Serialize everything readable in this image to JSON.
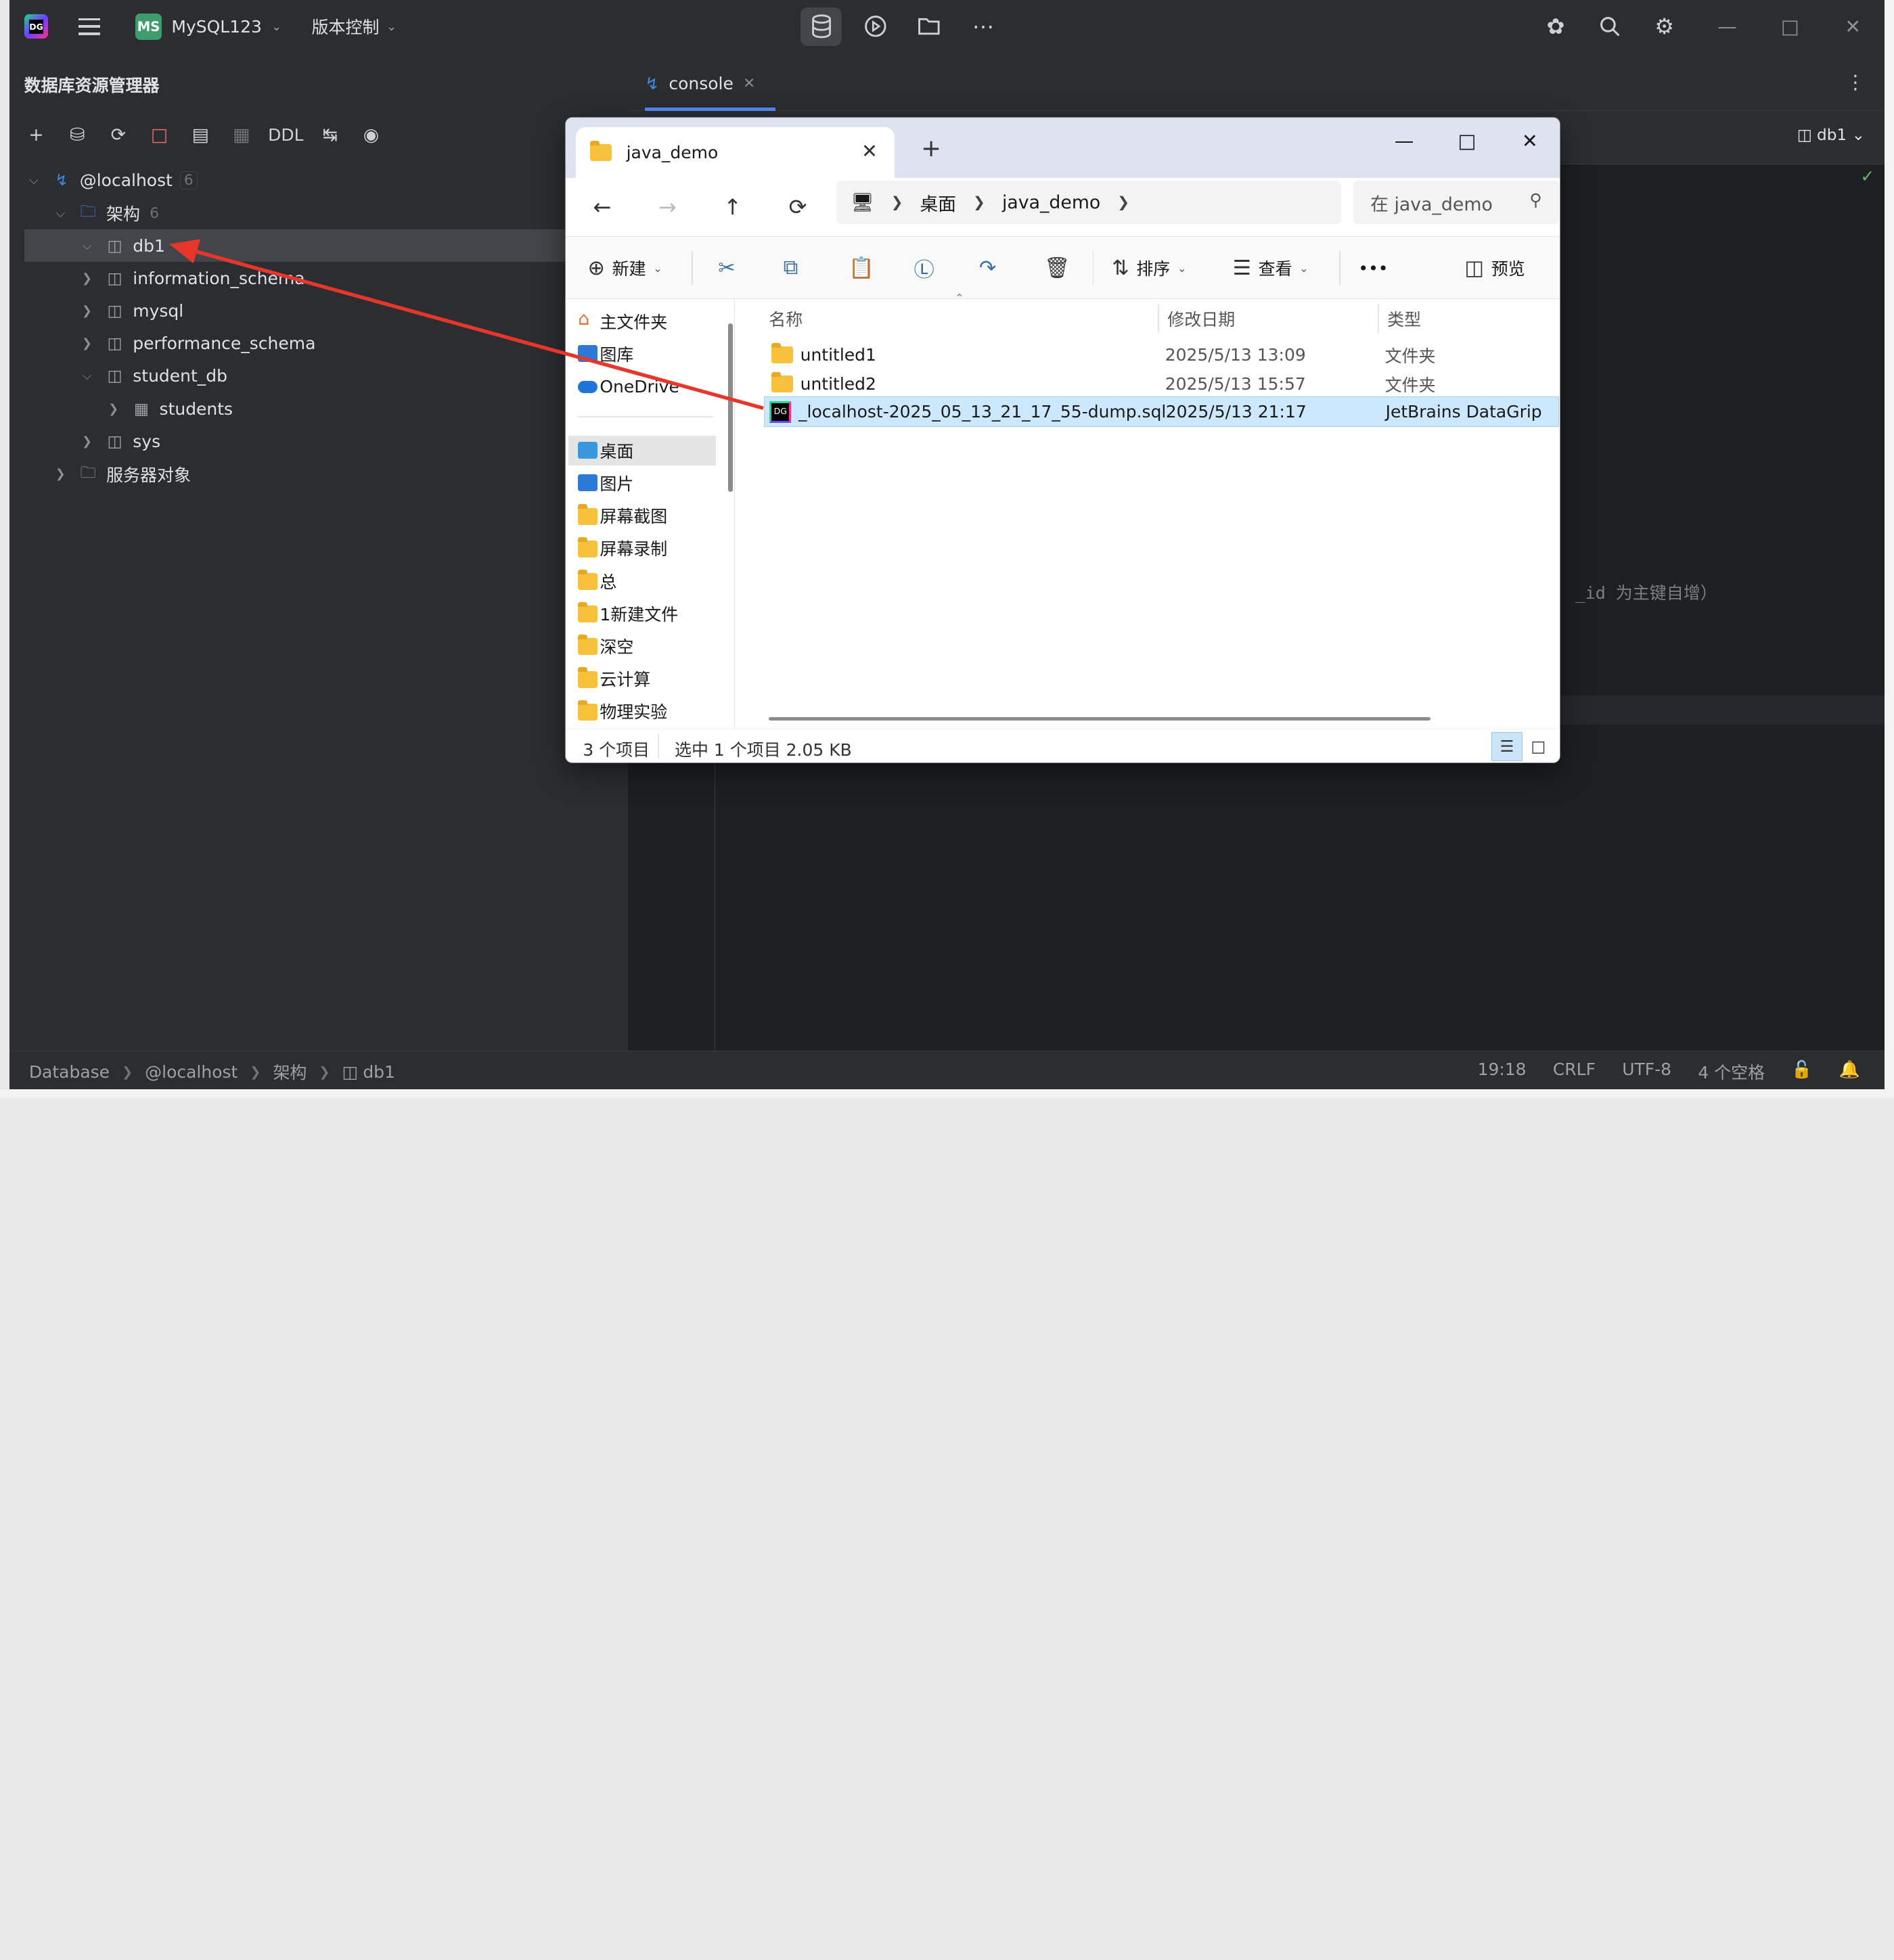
{
  "ide": {
    "project": {
      "badge": "MS",
      "name": "MySQL123"
    },
    "vcs": "版本控制",
    "panel_title": "数据库资源管理器",
    "toolbar_ddl": "DDL",
    "tree": [
      {
        "label": "@localhost",
        "count": "6"
      },
      {
        "label": "架构",
        "count": "6"
      },
      {
        "label": "db1"
      },
      {
        "label": "information_schema"
      },
      {
        "label": "mysql"
      },
      {
        "label": "performance_schema"
      },
      {
        "label": "student_db"
      },
      {
        "label": "students"
      },
      {
        "label": "sys"
      },
      {
        "label": "服务器对象"
      }
    ],
    "editor_tab": "console",
    "db_selector": "db1",
    "hint_text": "_id 为主键自增）",
    "status": {
      "crumbs": [
        "Database",
        "@localhost",
        "架构",
        "db1"
      ],
      "position": "19:18",
      "line_sep": "CRLF",
      "encoding": "UTF-8",
      "indent": "4 个空格"
    }
  },
  "explorer": {
    "tab_title": "java_demo",
    "address": [
      "桌面",
      "java_demo"
    ],
    "search_placeholder": "在 java_demo",
    "commands": {
      "new": "新建",
      "sort": "排序",
      "view": "查看",
      "more": "•••",
      "preview": "预览"
    },
    "sidebar_top": [
      "主文件夹",
      "图库",
      "OneDrive -"
    ],
    "sidebar_pinned": [
      "桌面",
      "图片",
      "屏幕截图",
      "屏幕录制",
      "总",
      "1新建文件",
      "深空",
      "云计算",
      "物理实验"
    ],
    "columns": {
      "name": "名称",
      "date": "修改日期",
      "type": "类型"
    },
    "files": [
      {
        "name": "untitled1",
        "date": "2025/5/13 13:09",
        "type": "文件夹"
      },
      {
        "name": "untitled2",
        "date": "2025/5/13 15:57",
        "type": "文件夹"
      },
      {
        "name": "_localhost-2025_05_13_21_17_55-dump.sql",
        "date": "2025/5/13 21:17",
        "type": "JetBrains DataGrip"
      }
    ],
    "status_count": "3 个项目",
    "status_selected": "选中 1 个项目  2.05 KB"
  },
  "colors": {
    "ide_bg": "#1e1f22",
    "panel_bg": "#2b2d30",
    "accent": "#548af7",
    "arrow": "#e8372a",
    "selection": "#cce8ff"
  }
}
